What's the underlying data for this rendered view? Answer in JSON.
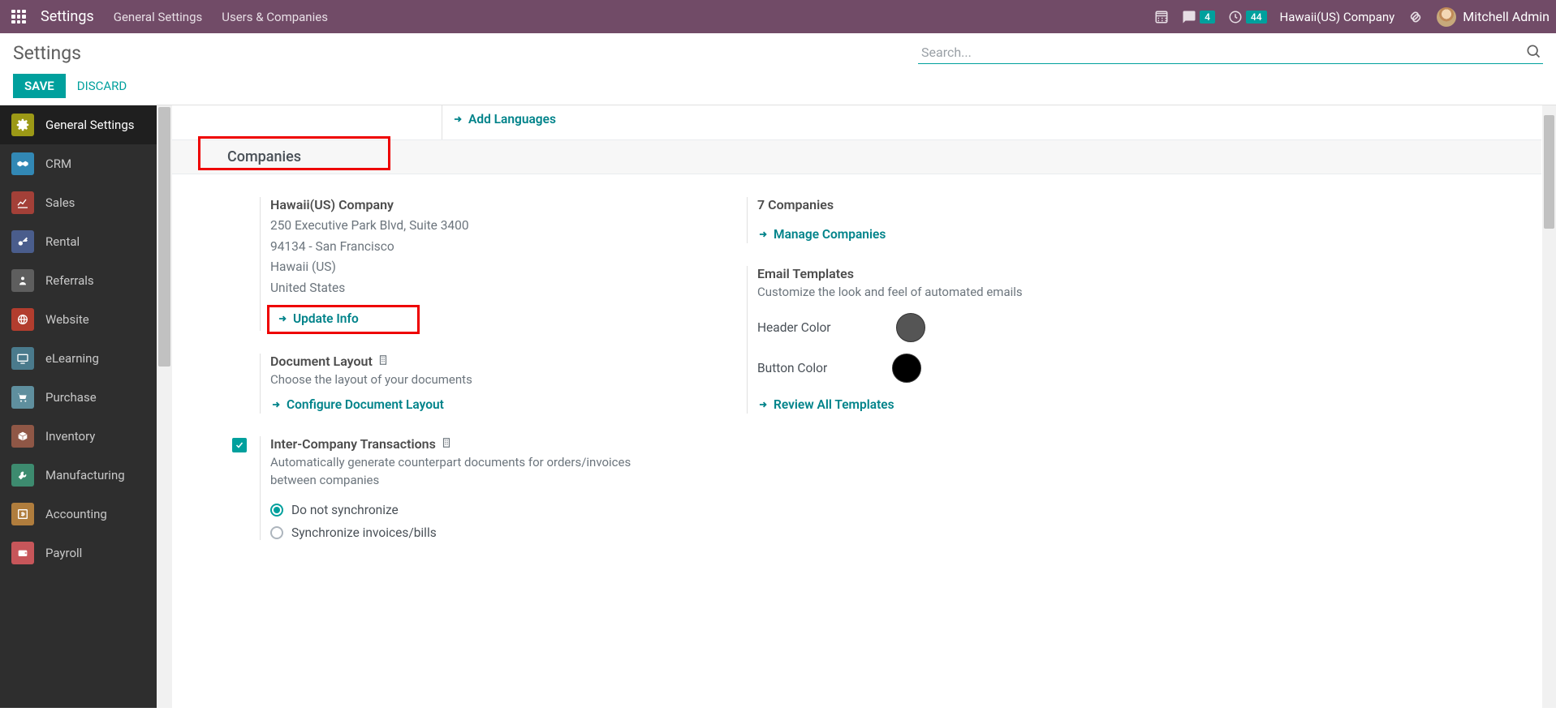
{
  "topbar": {
    "app_title": "Settings",
    "menu_general": "General Settings",
    "menu_users": "Users & Companies",
    "msg_badge": "4",
    "clock_badge": "44",
    "company": "Hawaii(US) Company",
    "user_name": "Mitchell Admin"
  },
  "control_panel": {
    "breadcrumb": "Settings",
    "save": "SAVE",
    "discard": "DISCARD",
    "search_placeholder": "Search..."
  },
  "sidebar": {
    "items": [
      {
        "label": "General Settings"
      },
      {
        "label": "CRM"
      },
      {
        "label": "Sales"
      },
      {
        "label": "Rental"
      },
      {
        "label": "Referrals"
      },
      {
        "label": "Website"
      },
      {
        "label": "eLearning"
      },
      {
        "label": "Purchase"
      },
      {
        "label": "Inventory"
      },
      {
        "label": "Manufacturing"
      },
      {
        "label": "Accounting"
      },
      {
        "label": "Payroll"
      }
    ]
  },
  "content": {
    "add_languages": "Add Languages",
    "section_companies": "Companies",
    "company": {
      "name": "Hawaii(US) Company",
      "addr1": "250 Executive Park Blvd, Suite 3400",
      "addr2": "94134 - San Francisco",
      "addr3": "Hawaii (US)",
      "addr4": "United States",
      "update": "Update Info"
    },
    "doc_layout": {
      "title": "Document Layout",
      "desc": "Choose the layout of your documents",
      "action": "Configure Document Layout"
    },
    "interco": {
      "title": "Inter-Company Transactions",
      "desc": "Automatically generate counterpart documents for orders/invoices between companies",
      "opt1": "Do not synchronize",
      "opt2": "Synchronize invoices/bills"
    },
    "companies_count": "7 Companies",
    "manage": "Manage Companies",
    "email_tpl": {
      "title": "Email Templates",
      "desc": "Customize the look and feel of automated emails",
      "header_color": "Header Color",
      "button_color": "Button Color",
      "review": "Review All Templates"
    }
  },
  "colors": {
    "primary": "#00A09D",
    "topbar": "#714B67",
    "highlight_red": "#EE0000"
  }
}
